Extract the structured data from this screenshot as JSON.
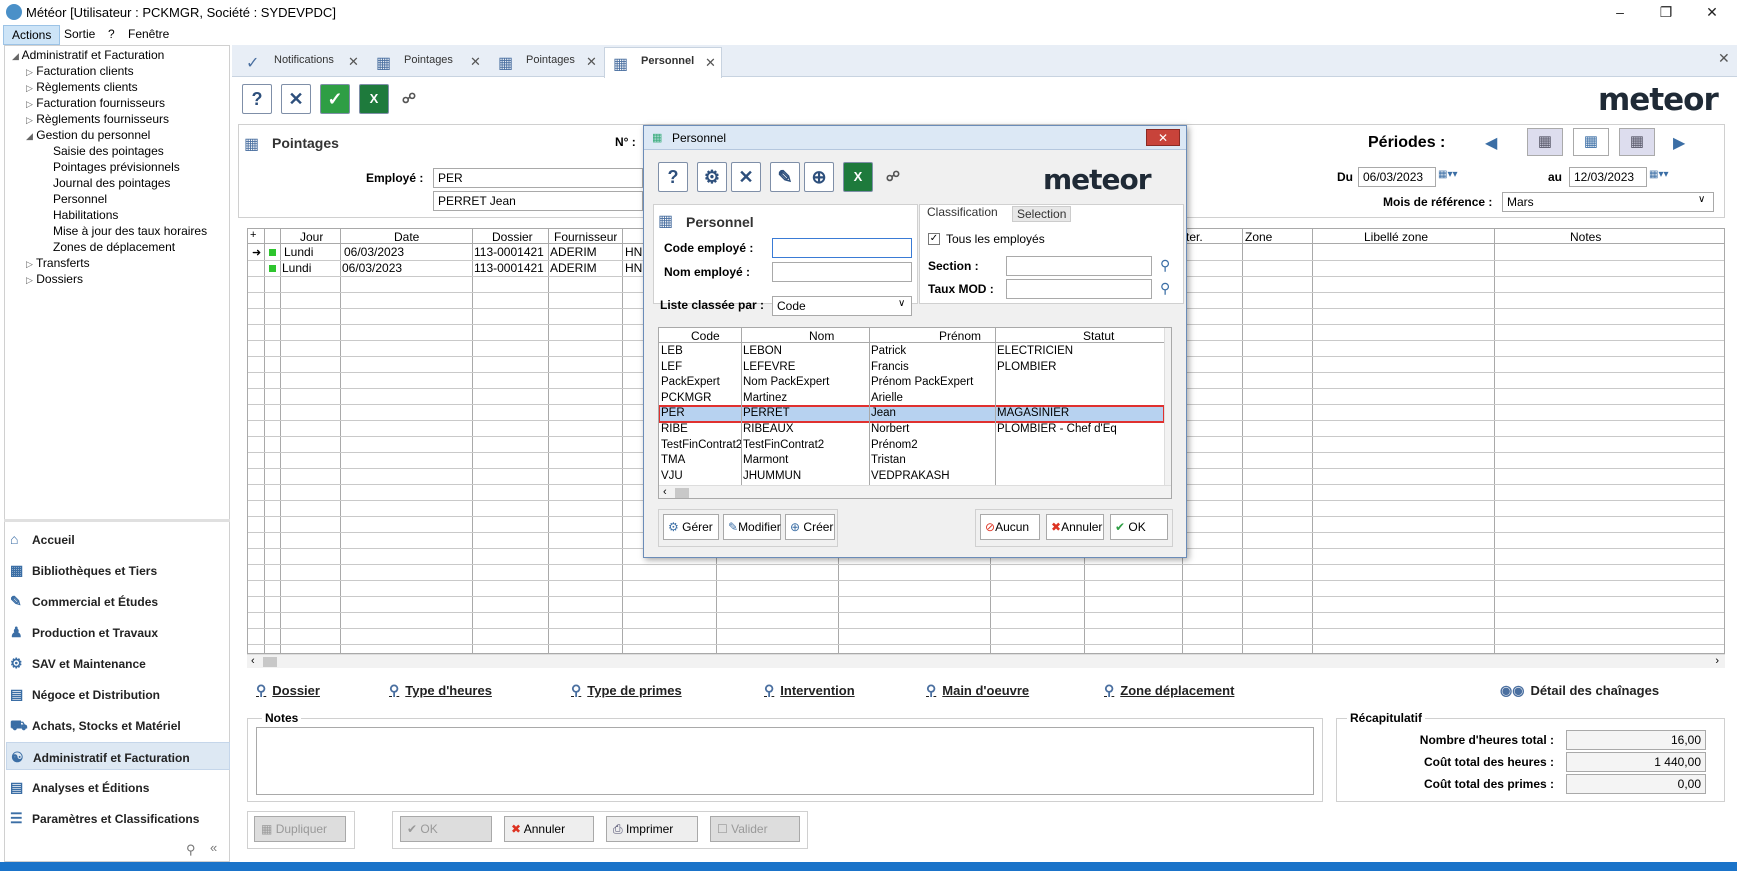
{
  "window": {
    "title": "Météor [Utilisateur : PCKMGR, Société : SYDEVPDC]"
  },
  "menu": [
    "Actions",
    "Sortie",
    "?",
    "Fenêtre"
  ],
  "tree": {
    "root": "Administratif et Facturation",
    "items": [
      "Facturation clients",
      "Règlements clients",
      "Facturation fournisseurs",
      "Règlements fournisseurs",
      "Gestion du personnel"
    ],
    "sub": [
      "Saisie des pointages",
      "Pointages prévisionnels",
      "Journal des pointages",
      "Personnel",
      "Habilitations",
      "Mise à jour des taux horaires",
      "Zones de déplacement"
    ],
    "after": [
      "Transferts",
      "Dossiers"
    ]
  },
  "nav": [
    "Accueil",
    "Bibliothèques et Tiers",
    "Commercial et Études",
    "Production et Travaux",
    "SAV et Maintenance",
    "Négoce et Distribution",
    "Achats, Stocks et Matériel",
    "Administratif et Facturation",
    "Analyses et Éditions",
    "Paramètres et Classifications"
  ],
  "tabs": [
    "Notifications",
    "Pointages",
    "Pointages",
    "Personnel"
  ],
  "brand": "meteor",
  "form": {
    "title": "Pointages",
    "no_label": "N° :",
    "employe_label": "Employé :",
    "employe_code": "PER",
    "employe_name": "PERRET  Jean",
    "periodes_label": "Périodes :",
    "du_label": "Du",
    "du_value": "06/03/2023",
    "au_label": "au",
    "au_value": "12/03/2023",
    "mois_label": "Mois de référence :",
    "mois_value": "Mars"
  },
  "grid": {
    "headers": [
      "Jour",
      "Date",
      "Dossier",
      "Fournisseur",
      "ter.",
      "Zone",
      "Libellé zone",
      "Notes"
    ],
    "rows": [
      {
        "jour": "Lundi",
        "date": "06/03/2023",
        "dossier": "113-0001421",
        "fournisseur": "ADERIM",
        "x": "HN"
      },
      {
        "jour": "Lundi",
        "date": "06/03/2023",
        "dossier": "113-0001421",
        "fournisseur": "ADERIM",
        "x": "HN"
      }
    ]
  },
  "links": [
    "Dossier",
    "Type d'heures",
    "Type de primes",
    "Intervention",
    "Main d'oeuvre",
    "Zone déplacement",
    "Détail des chaînages"
  ],
  "notes_label": "Notes",
  "recap": {
    "title": "Récapitulatif",
    "rows": [
      {
        "label": "Nombre d'heures total :",
        "value": "16,00"
      },
      {
        "label": "Coût total des heures :",
        "value": "1 440,00"
      },
      {
        "label": "Coût total des primes :",
        "value": "0,00"
      }
    ]
  },
  "footer_buttons": [
    "Dupliquer",
    "OK",
    "Annuler",
    "Imprimer",
    "Valider"
  ],
  "dialog": {
    "title": "Personnel",
    "heading": "Personnel",
    "code_label": "Code employé :",
    "code_value": "",
    "nom_label": "Nom employé :",
    "nom_value": "",
    "tab_classification": "Classification",
    "tab_selection": "Selection",
    "tous_label": "Tous les employés",
    "section_label": "Section :",
    "taux_label": "Taux MOD :",
    "liste_label": "Liste classée par :",
    "liste_value": "Code",
    "headers": [
      "Code",
      "Nom",
      "Prénom",
      "Statut"
    ],
    "rows": [
      {
        "code": "LEB",
        "nom": "LEBON",
        "prenom": "Patrick",
        "statut": "ELECTRICIEN"
      },
      {
        "code": "LEF",
        "nom": "LEFEVRE",
        "prenom": "Francis",
        "statut": "PLOMBIER"
      },
      {
        "code": "PackExpert",
        "nom": "Nom PackExpert",
        "prenom": "Prénom PackExpert",
        "statut": ""
      },
      {
        "code": "PCKMGR",
        "nom": "Martinez",
        "prenom": "Arielle",
        "statut": ""
      },
      {
        "code": "PER",
        "nom": "PERRET",
        "prenom": "Jean",
        "statut": "MAGASINIER"
      },
      {
        "code": "RIBE",
        "nom": "RIBEAUX",
        "prenom": "Norbert",
        "statut": "PLOMBIER - Chef d'Equ"
      },
      {
        "code": "TestFinContrat2",
        "nom": "TestFinContrat2",
        "prenom": "Prénom2",
        "statut": ""
      },
      {
        "code": "TMA",
        "nom": "Marmont",
        "prenom": "Tristan",
        "statut": ""
      },
      {
        "code": "VJU",
        "nom": "JHUMMUN",
        "prenom": "VEDPRAKASH",
        "statut": ""
      }
    ],
    "buttons_left": [
      "Gérer",
      "Modifier",
      "Créer"
    ],
    "buttons_right": [
      "Aucun",
      "Annuler",
      "OK"
    ]
  }
}
